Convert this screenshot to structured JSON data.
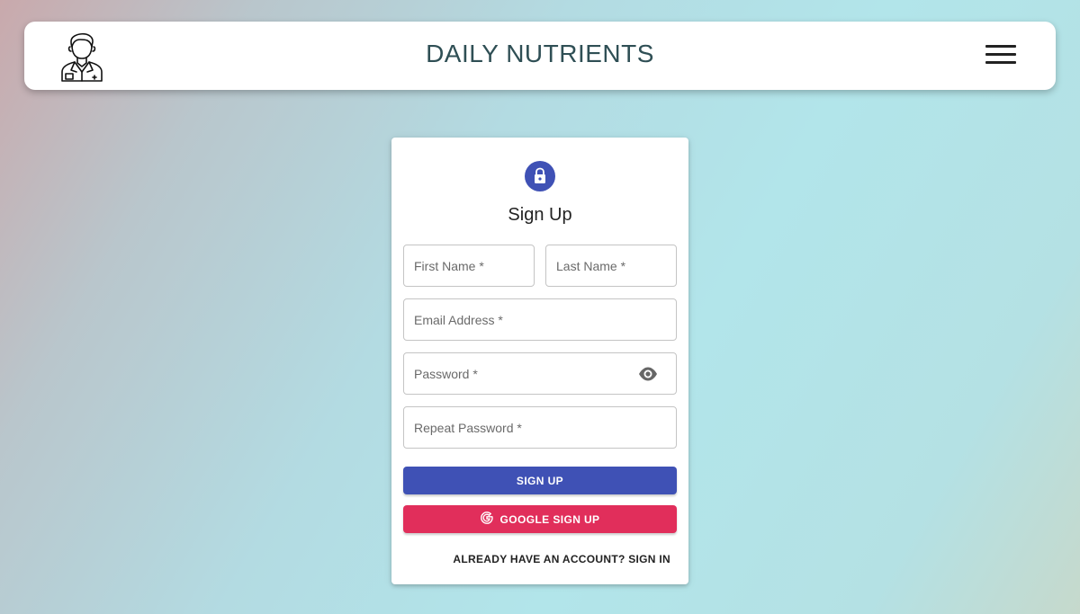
{
  "header": {
    "title": "DAILY NUTRIENTS",
    "logo_icon": "doctor-icon",
    "menu_icon": "hamburger-menu-icon"
  },
  "form": {
    "lock_icon": "lock-icon",
    "accent_color": "#3f51b5",
    "title": "Sign Up",
    "first_name": {
      "placeholder": "First Name *",
      "value": ""
    },
    "last_name": {
      "placeholder": "Last Name *",
      "value": ""
    },
    "email": {
      "placeholder": "Email Address *",
      "value": ""
    },
    "password": {
      "placeholder": "Password *",
      "value": "",
      "toggle_icon": "eye-icon"
    },
    "repeat_password": {
      "placeholder": "Repeat Password *",
      "value": ""
    },
    "signup_label": "SIGN UP",
    "google_label": "GOOGLE SIGN UP",
    "google_color": "#e12e5b",
    "google_icon": "google-icon",
    "signin_link": "ALREADY HAVE AN ACCOUNT? SIGN IN"
  }
}
